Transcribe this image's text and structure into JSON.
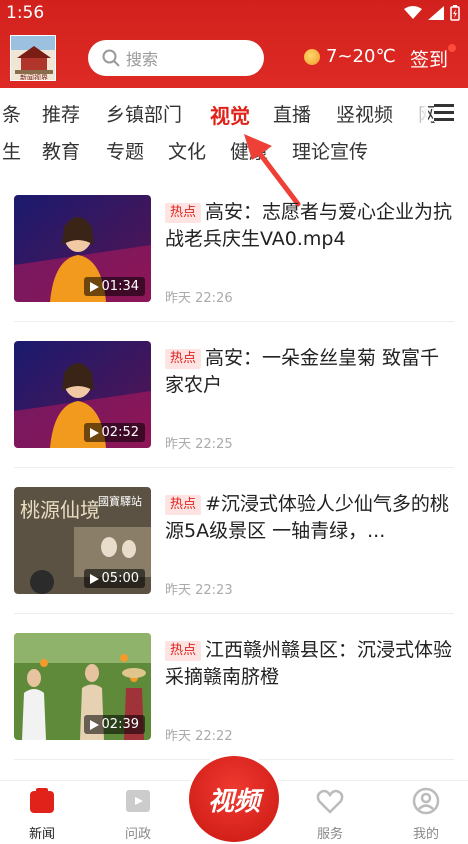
{
  "status_bar": {
    "time": "1:56"
  },
  "header": {
    "logo_text": "新闻视界",
    "search_placeholder": "搜索",
    "weather": "7~20℃",
    "signin": "签到"
  },
  "tabs_row1": [
    {
      "label": "条"
    },
    {
      "label": "推荐"
    },
    {
      "label": "乡镇部门"
    },
    {
      "label": "视觉",
      "active": true
    },
    {
      "label": "直播"
    },
    {
      "label": "竖视频"
    },
    {
      "label": "网"
    }
  ],
  "tabs_row2": [
    {
      "label": "生"
    },
    {
      "label": "教育"
    },
    {
      "label": "专题"
    },
    {
      "label": "文化"
    },
    {
      "label": "健康"
    },
    {
      "label": "理论宣传"
    }
  ],
  "badge_label": "热点",
  "news": [
    {
      "title": "高安：志愿者与爱心企业为抗战老兵庆生VA0.mp4",
      "duration": "01:34",
      "time": "昨天 22:26"
    },
    {
      "title": "高安：一朵金丝皇菊 致富千家农户",
      "duration": "02:52",
      "time": "昨天 22:25"
    },
    {
      "title": "#沉浸式体验人少仙气多的桃源5A级景区 一轴青绿，...",
      "duration": "05:00",
      "time": "昨天 22:23"
    },
    {
      "title": "江西赣州赣县区：沉浸式体验采摘赣南脐橙",
      "duration": "02:39",
      "time": "昨天 22:22"
    }
  ],
  "thumb3_text": {
    "left": "桃源仙境",
    "right": "國寶驛站"
  },
  "bottom_nav": {
    "news": "新闻",
    "ask": "问政",
    "center": "视频",
    "service": "服务",
    "mine": "我的"
  },
  "colors": {
    "brand_red": "#e0221b"
  }
}
